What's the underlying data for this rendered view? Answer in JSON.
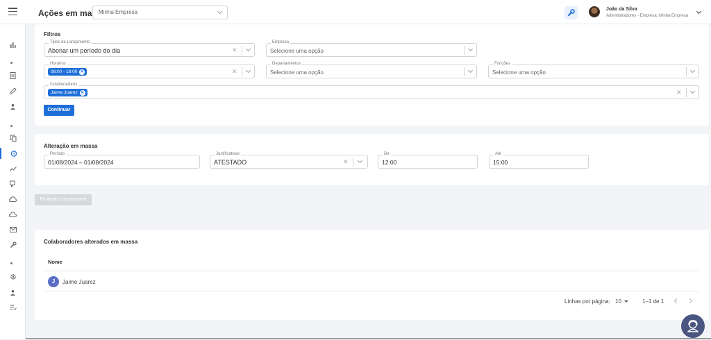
{
  "header": {
    "page_title": "Ações em massa",
    "company_select_value": "Minha Empresa",
    "user_name": "João da Silva",
    "user_role": "Administradores - Empresa: Minha Empresa"
  },
  "filters": {
    "title": "Filtros",
    "tipos_label": "Tipos de Lançamento",
    "tipos_value": "Abonar um período do dia",
    "empresa_label": "Empresa",
    "empresa_placeholder": "Selecione uma opção",
    "horarios_label": "Horários",
    "horarios_chip": "08:00 - 18:00",
    "departamentos_label": "Departamentos",
    "departamentos_placeholder": "Selecione uma opção",
    "funcoes_label": "Funções",
    "funcoes_placeholder": "Selecione uma opção",
    "colaboradores_label": "Colaboradores",
    "colaboradores_chip": "Jaime Juarez",
    "continue_label": "Continuar"
  },
  "mass_change": {
    "title": "Alteração em massa",
    "periodo_label": "Período",
    "periodo_value": "01/08/2024 – 01/08/2024",
    "justificativas_label": "Justificativas",
    "justificativas_value": "ATESTADO",
    "de_label": "De",
    "de_value": "12:00",
    "ate_label": "Até",
    "ate_value": "15:00"
  },
  "finalize_label": "Finalizar Lançamento",
  "altered": {
    "title": "Colaboradores alterados em massa",
    "column_nome": "Nome",
    "rows": [
      {
        "initial": "J",
        "name": "Jaime Juarez"
      }
    ],
    "rows_per_page_label": "Linhas por página:",
    "rows_per_page_value": "10",
    "range_text": "1–1 de 1"
  },
  "colors": {
    "accent": "#1e6fd9",
    "background": "#f2f4f7",
    "support_button": "#4a5680",
    "row_avatar": "#5b6fc9"
  },
  "icons": {
    "sidebar": [
      "bar-chart-icon",
      "document-icon",
      "pen-icon",
      "user-icon",
      "copy-icon",
      "alarm-clock-icon",
      "trend-icon",
      "chat-icon",
      "cloud-upload-icon",
      "cloud-download-icon",
      "mail-icon",
      "wrench-icon",
      "gear-icon",
      "user-icon",
      "checklist-icon"
    ],
    "header": [
      "menu-icon",
      "wrench-icon",
      "chevron-down-icon"
    ]
  }
}
